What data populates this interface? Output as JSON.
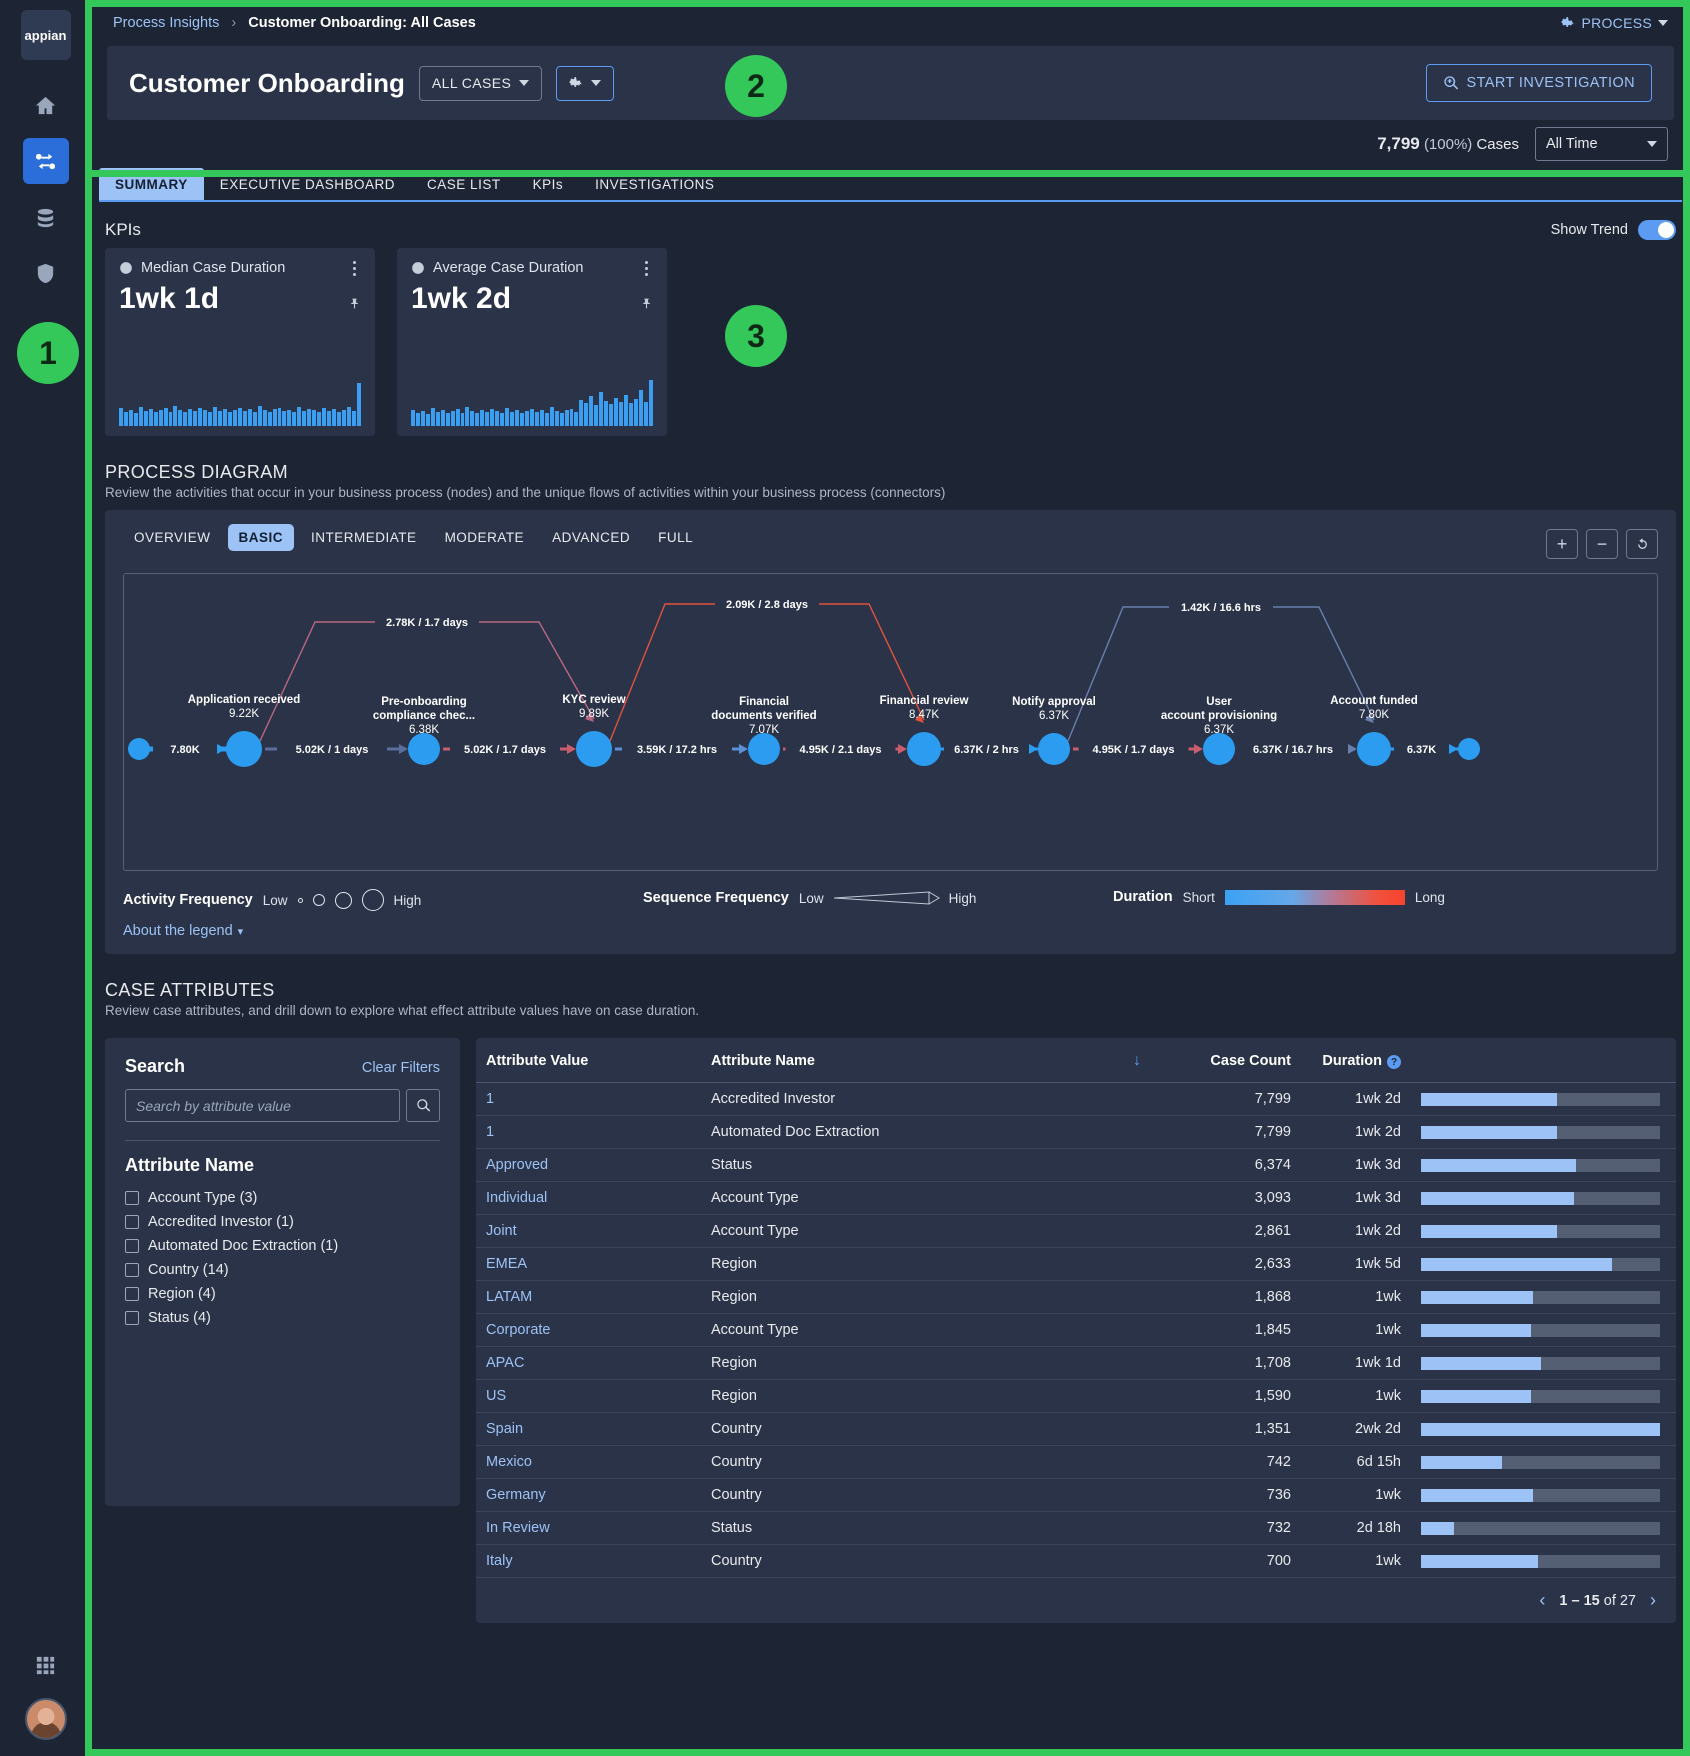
{
  "rail": {
    "logo": "appian",
    "items": [
      {
        "name": "home-icon",
        "label": "Home"
      },
      {
        "name": "process-icon",
        "label": "Process Insights"
      },
      {
        "name": "data-icon",
        "label": "Data"
      },
      {
        "name": "shield-icon",
        "label": "Security"
      },
      {
        "name": "apps-grid-icon",
        "label": "Apps"
      }
    ]
  },
  "breadcrumb": {
    "parent": "Process Insights",
    "separator": "›",
    "current": "Customer Onboarding: All Cases",
    "process_menu": "PROCESS"
  },
  "header": {
    "title": "Customer Onboarding",
    "cases_filter": "ALL CASES",
    "settings_icon": "gear-icon",
    "start_investigation": "START INVESTIGATION",
    "count_value": "7,799",
    "count_pct": "(100%)",
    "count_word": "Cases",
    "time_range": "All Time"
  },
  "tabs": [
    {
      "label": "SUMMARY",
      "active": true
    },
    {
      "label": "EXECUTIVE DASHBOARD",
      "active": false
    },
    {
      "label": "CASE LIST",
      "active": false
    },
    {
      "label": "KPIs",
      "active": false
    },
    {
      "label": "INVESTIGATIONS",
      "active": false
    }
  ],
  "kpis": {
    "section_title": "KPIs",
    "show_trend_label": "Show Trend",
    "cards": [
      {
        "label": "Median Case Duration",
        "value": "1wk 1d"
      },
      {
        "label": "Average Case Duration",
        "value": "1wk 2d"
      }
    ]
  },
  "process_diagram": {
    "title": "PROCESS DIAGRAM",
    "subtitle": "Review the activities that occur in your business process (nodes) and the unique flows of activities within your business process (connectors)",
    "levels": [
      {
        "label": "OVERVIEW",
        "active": false
      },
      {
        "label": "BASIC",
        "active": true
      },
      {
        "label": "INTERMEDIATE",
        "active": false
      },
      {
        "label": "MODERATE",
        "active": false
      },
      {
        "label": "ADVANCED",
        "active": false
      },
      {
        "label": "FULL",
        "active": false
      }
    ],
    "zoom_in": "+",
    "zoom_out": "−",
    "reset": "reset-icon",
    "nodes": [
      {
        "label": "",
        "count": "",
        "size": 11
      },
      {
        "label": "Application received",
        "count": "9.22K",
        "size": 18
      },
      {
        "label": "Pre-onboarding compliance chec...",
        "count": "6.38K",
        "size": 16
      },
      {
        "label": "KYC review",
        "count": "9.89K",
        "size": 18
      },
      {
        "label": "Financial documents verified",
        "count": "7.07K",
        "size": 16
      },
      {
        "label": "Financial review",
        "count": "8.47K",
        "size": 17
      },
      {
        "label": "Notify approval",
        "count": "6.37K",
        "size": 16
      },
      {
        "label": "User account provisioning",
        "count": "6.37K",
        "size": 16
      },
      {
        "label": "Account funded",
        "count": "7.80K",
        "size": 17
      },
      {
        "label": "",
        "count": "",
        "size": 11
      }
    ],
    "edges_straight": [
      "7.80K",
      "5.02K / 1 days",
      "5.02K / 1.7 days",
      "3.59K / 17.2 hrs",
      "4.95K / 2.1 days",
      "6.37K / 2 hrs",
      "4.95K / 1.7 days",
      "6.37K / 16.7 hrs",
      "6.37K"
    ],
    "edges_arc": [
      "2.78K / 1.7 days",
      "2.09K / 2.8 days",
      "1.42K / 16.6 hrs"
    ],
    "legend": {
      "activity_frequency": "Activity Frequency",
      "sequence_frequency": "Sequence Frequency",
      "duration": "Duration",
      "low": "Low",
      "high": "High",
      "short": "Short",
      "long": "Long",
      "about": "About the legend"
    }
  },
  "case_attributes": {
    "title": "CASE ATTRIBUTES",
    "subtitle": "Review case attributes, and drill down to explore what effect attribute values have on case duration.",
    "search_title": "Search",
    "clear_filters": "Clear Filters",
    "search_placeholder": "Search by attribute value",
    "search_value": "",
    "attribute_name_title": "Attribute Name",
    "filters": [
      "Account Type (3)",
      "Accredited Investor (1)",
      "Automated Doc Extraction (1)",
      "Country (14)",
      "Region (4)",
      "Status (4)"
    ],
    "columns": [
      "Attribute Value",
      "Attribute Name",
      "",
      "Case Count",
      "Duration"
    ],
    "rows": [
      {
        "value": "1",
        "name": "Accredited Investor",
        "count": "7,799",
        "duration": "1wk 2d",
        "bar": 57
      },
      {
        "value": "1",
        "name": "Automated Doc Extraction",
        "count": "7,799",
        "duration": "1wk 2d",
        "bar": 57
      },
      {
        "value": "Approved",
        "name": "Status",
        "count": "6,374",
        "duration": "1wk 3d",
        "bar": 65
      },
      {
        "value": "Individual",
        "name": "Account Type",
        "count": "3,093",
        "duration": "1wk 3d",
        "bar": 64
      },
      {
        "value": "Joint",
        "name": "Account Type",
        "count": "2,861",
        "duration": "1wk 2d",
        "bar": 57
      },
      {
        "value": "EMEA",
        "name": "Region",
        "count": "2,633",
        "duration": "1wk 5d",
        "bar": 80
      },
      {
        "value": "LATAM",
        "name": "Region",
        "count": "1,868",
        "duration": "1wk",
        "bar": 47
      },
      {
        "value": "Corporate",
        "name": "Account Type",
        "count": "1,845",
        "duration": "1wk",
        "bar": 46
      },
      {
        "value": "APAC",
        "name": "Region",
        "count": "1,708",
        "duration": "1wk 1d",
        "bar": 50
      },
      {
        "value": "US",
        "name": "Region",
        "count": "1,590",
        "duration": "1wk",
        "bar": 46
      },
      {
        "value": "Spain",
        "name": "Country",
        "count": "1,351",
        "duration": "2wk 2d",
        "bar": 100
      },
      {
        "value": "Mexico",
        "name": "Country",
        "count": "742",
        "duration": "6d 15h",
        "bar": 34
      },
      {
        "value": "Germany",
        "name": "Country",
        "count": "736",
        "duration": "1wk",
        "bar": 47
      },
      {
        "value": "In Review",
        "name": "Status",
        "count": "732",
        "duration": "2d 18h",
        "bar": 14
      },
      {
        "value": "Italy",
        "name": "Country",
        "count": "700",
        "duration": "1wk",
        "bar": 49
      }
    ],
    "pager": {
      "range": "1 – 15",
      "of": "of 27",
      "prev": "‹",
      "next": "›"
    }
  },
  "callouts": [
    {
      "n": "1"
    },
    {
      "n": "2"
    },
    {
      "n": "3"
    }
  ]
}
